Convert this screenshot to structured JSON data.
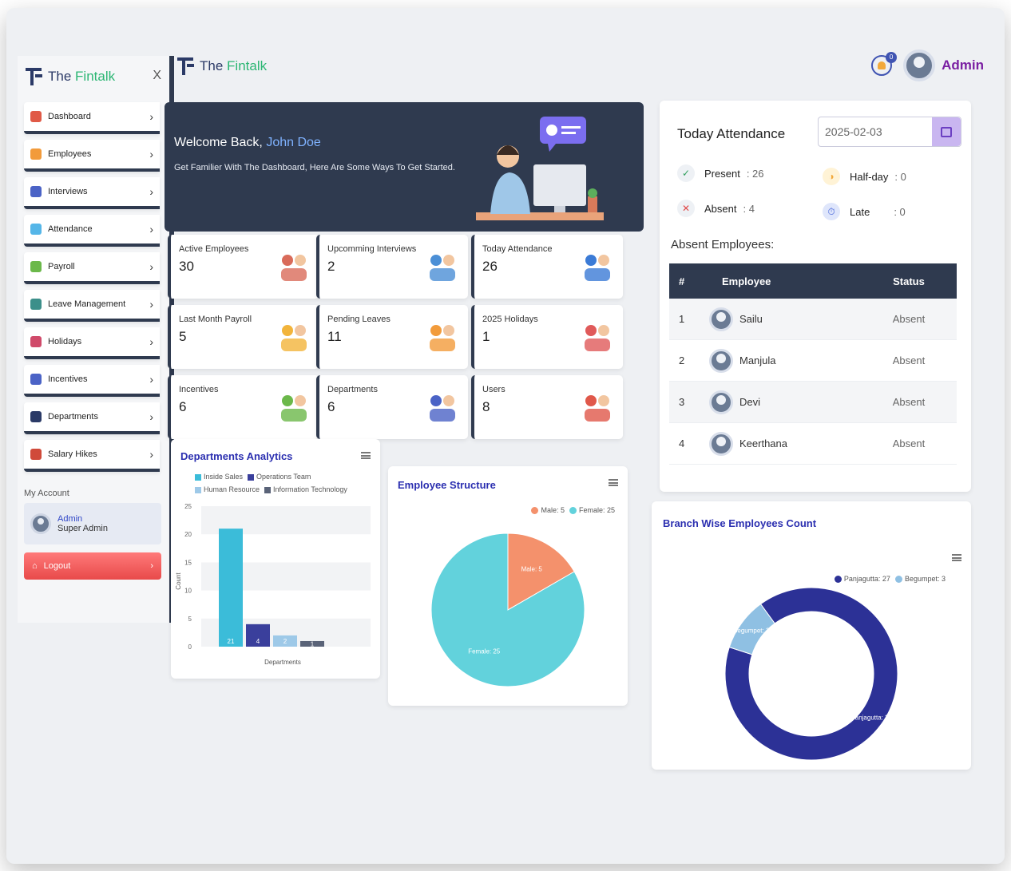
{
  "brand": {
    "the": "The",
    "name": "Fintalk"
  },
  "sidebar": {
    "close": "X",
    "items": [
      {
        "label": "Dashboard",
        "color": "#e05a47"
      },
      {
        "label": "Employees",
        "color": "#f29b3b"
      },
      {
        "label": "Interviews",
        "color": "#4b63c6"
      },
      {
        "label": "Attendance",
        "color": "#55b6e8"
      },
      {
        "label": "Payroll",
        "color": "#6bb84a"
      },
      {
        "label": "Leave Management",
        "color": "#3c8f8a"
      },
      {
        "label": "Holidays",
        "color": "#d04a6a"
      },
      {
        "label": "Incentives",
        "color": "#4b63c6"
      },
      {
        "label": "Departments",
        "color": "#2b3a67"
      },
      {
        "label": "Salary Hikes",
        "color": "#d04a3a"
      }
    ],
    "account_title": "My Account",
    "account_name": "Admin",
    "account_role": "Super Admin",
    "logout": "Logout"
  },
  "topbar": {
    "notifications": "0",
    "user": "Admin"
  },
  "welcome": {
    "greeting": "Welcome Back,",
    "user": "John Doe",
    "subtitle": "Get Familier With The Dashboard, Here Are Some Ways To Get Started."
  },
  "cards": [
    {
      "title": "Active Employees",
      "value": "30",
      "icon": "team-icon"
    },
    {
      "title": "Upcomming Interviews",
      "value": "2",
      "icon": "interview-icon"
    },
    {
      "title": "Today Attendance",
      "value": "26",
      "icon": "attendance-icon"
    },
    {
      "title": "Last Month Payroll",
      "value": "5",
      "icon": "payroll-icon"
    },
    {
      "title": "Pending Leaves",
      "value": "11",
      "icon": "stopwatch-icon"
    },
    {
      "title": "2025 Holidays",
      "value": "1",
      "icon": "calendar-holiday-icon"
    },
    {
      "title": "Incentives",
      "value": "6",
      "icon": "incentive-icon"
    },
    {
      "title": "Departments",
      "value": "6",
      "icon": "building-icon"
    },
    {
      "title": "Users",
      "value": "8",
      "icon": "users-icon"
    }
  ],
  "attendance": {
    "title": "Today Attendance",
    "date": "2025-02-03",
    "present_label": "Present",
    "present_value": ": 26",
    "halfday_label": "Half-day",
    "halfday_value": ": 0",
    "absent_label": "Absent",
    "absent_value": ": 4",
    "late_label": "Late",
    "late_value": ": 0",
    "absent_title": "Absent Employees:",
    "headers": {
      "num": "#",
      "employee": "Employee",
      "status": "Status"
    },
    "rows": [
      {
        "num": "1",
        "name": "Sailu",
        "status": "Absent"
      },
      {
        "num": "2",
        "name": "Manjula",
        "status": "Absent"
      },
      {
        "num": "3",
        "name": "Devi",
        "status": "Absent"
      },
      {
        "num": "4",
        "name": "Keerthana",
        "status": "Absent"
      }
    ]
  },
  "chart_data": [
    {
      "type": "bar",
      "title": "Departments Analytics",
      "xlabel": "Departments",
      "ylabel": "Count",
      "ylim": [
        0,
        25
      ],
      "yticks": [
        0,
        5,
        10,
        15,
        20,
        25
      ],
      "series": [
        {
          "name": "Inside Sales",
          "value": 21,
          "color": "#3bbcd9"
        },
        {
          "name": "Operations Team",
          "value": 4,
          "color": "#3a3f9c"
        },
        {
          "name": "Human Resource",
          "value": 2,
          "color": "#9ec9e8"
        },
        {
          "name": "Information Technology",
          "value": 1,
          "color": "#5a6378"
        }
      ]
    },
    {
      "type": "pie",
      "title": "Employee Structure",
      "slices": [
        {
          "name": "Male",
          "value": 5,
          "label": "Male: 5",
          "color": "#f4916c"
        },
        {
          "name": "Female",
          "value": 25,
          "label": "Female: 25",
          "color": "#62d2dc"
        }
      ]
    },
    {
      "type": "pie",
      "title": "Branch Wise Employees Count",
      "slices": [
        {
          "name": "Panjagutta",
          "value": 27,
          "label": "Panjagutta: 27",
          "color": "#2c3196"
        },
        {
          "name": "Begumpet",
          "value": 3,
          "label": "Begumpet: 3",
          "color": "#8fc0e3"
        }
      ]
    }
  ]
}
